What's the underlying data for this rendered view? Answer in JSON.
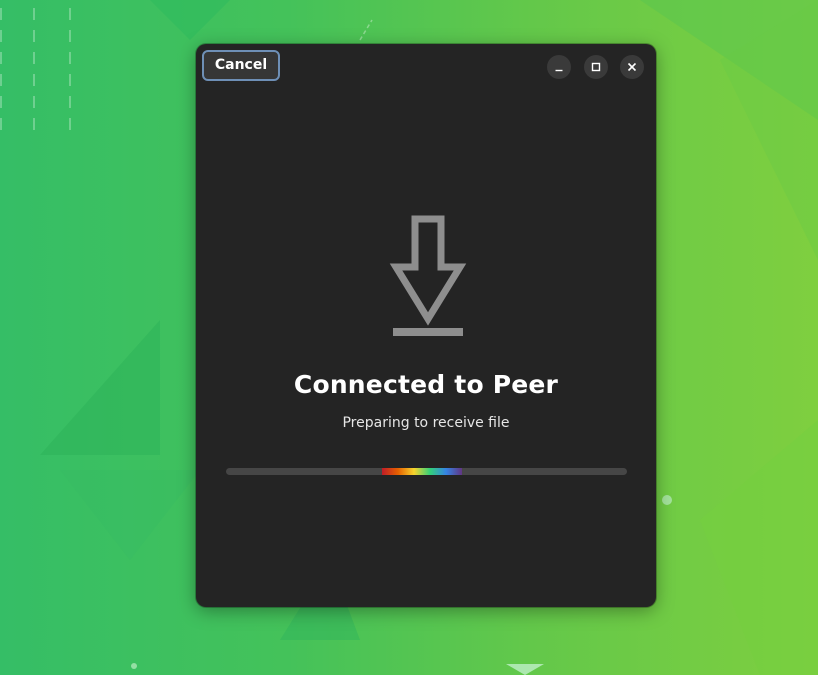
{
  "window": {
    "cancel_label": "Cancel",
    "controls": {
      "minimize_icon": "minimize-icon",
      "maximize_icon": "maximize-icon",
      "close_icon": "close-icon"
    }
  },
  "status": {
    "icon": "download-arrow-icon",
    "title": "Connected to Peer",
    "subtitle": "Preparing to receive file"
  },
  "progress": {
    "indeterminate": true,
    "colors": [
      "#c01c28",
      "#e66100",
      "#f6d32d",
      "#33d17a",
      "#3584e4",
      "#613583"
    ]
  },
  "theme": {
    "window_bg": "#242424",
    "accent_border": "#6e8fb6",
    "track": "#464646",
    "desktop_green": "#4ec45a"
  }
}
